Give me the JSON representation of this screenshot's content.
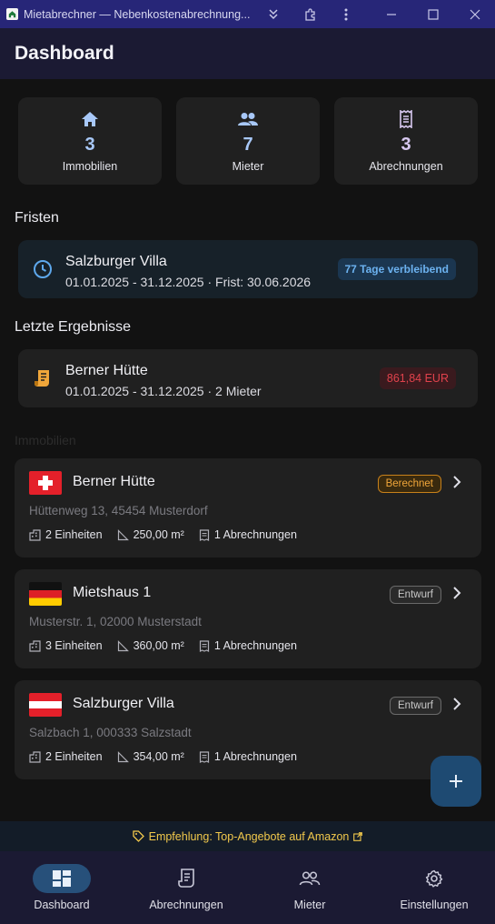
{
  "window": {
    "title": "Mietabrechner — Nebenkostenabrechnung..."
  },
  "appbar": {
    "title": "Dashboard"
  },
  "stats": [
    {
      "value": "3",
      "label": "Immobilien",
      "icon": "home-icon",
      "color": "#a8c8f8"
    },
    {
      "value": "7",
      "label": "Mieter",
      "icon": "people-icon",
      "color": "#a8c8f8"
    },
    {
      "value": "3",
      "label": "Abrechnungen",
      "icon": "receipt-icon",
      "color": "#d8c8f0"
    }
  ],
  "deadlines": {
    "title": "Fristen",
    "items": [
      {
        "name": "Salzburger Villa",
        "subtitle": "01.01.2025 - 31.12.2025 · Frist: 30.06.2026",
        "badge": "77 Tage verbleibend"
      }
    ]
  },
  "results": {
    "title": "Letzte Ergebnisse",
    "items": [
      {
        "name": "Berner Hütte",
        "subtitle": "01.01.2025 - 31.12.2025 · 2 Mieter",
        "amount": "861,84 EUR"
      }
    ]
  },
  "properties": {
    "title": "Immobilien",
    "items": [
      {
        "name": "Berner Hütte",
        "address": "Hüttenweg 13, 45454 Musterdorf",
        "status": "Berechnet",
        "units": "2 Einheiten",
        "area": "250,00 m²",
        "statements": "1 Abrechnungen",
        "flag": "switzerland-flag-icon"
      },
      {
        "name": "Mietshaus 1",
        "address": "Musterstr. 1, 02000 Musterstadt",
        "status": "Entwurf",
        "units": "3 Einheiten",
        "area": "360,00 m²",
        "statements": "1 Abrechnungen",
        "flag": "germany-flag-icon"
      },
      {
        "name": "Salzburger Villa",
        "address": "Salzbach 1, 000333 Salzstadt",
        "status": "Entwurf",
        "units": "2 Einheiten",
        "area": "354,00 m²",
        "statements": "1 Abrechnungen",
        "flag": "austria-flag-icon"
      }
    ]
  },
  "promo": {
    "text": "Empfehlung: Top-Angebote auf Amazon"
  },
  "nav": [
    {
      "label": "Dashboard",
      "icon": "dashboard-icon",
      "active": true
    },
    {
      "label": "Abrechnungen",
      "icon": "receipt-icon",
      "active": false
    },
    {
      "label": "Mieter",
      "icon": "people-icon",
      "active": false
    },
    {
      "label": "Einstellungen",
      "icon": "gear-icon",
      "active": false
    }
  ],
  "colors": {
    "accent": "#27507a",
    "status_done": "#f0a63a",
    "amount_negative": "#e0424c",
    "deadline_badge": "#6cb2f0"
  }
}
